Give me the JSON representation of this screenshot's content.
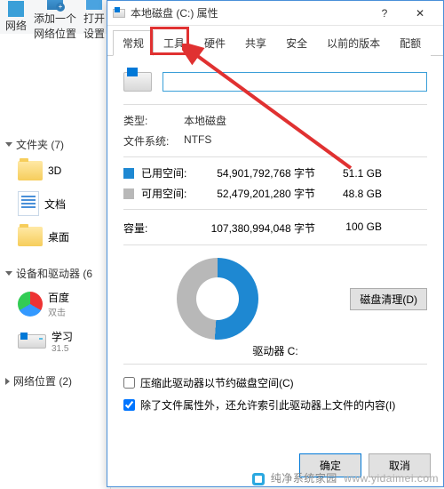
{
  "explorer": {
    "toolbar": {
      "net": "网络",
      "add_location": "添加一个\n网络位置",
      "open_settings": "打开\n设置"
    },
    "folders_title": "文件夹 (7)",
    "folders": [
      {
        "label": "3D"
      },
      {
        "label": "文档"
      },
      {
        "label": "桌面"
      }
    ],
    "devices_title": "设备和驱动器 (6",
    "devices": [
      {
        "label": "百度",
        "sub": "双击"
      },
      {
        "label": "学习",
        "sub": "31.5"
      }
    ],
    "netloc_title": "网络位置 (2)"
  },
  "dialog": {
    "title": "本地磁盘 (C:) 属性",
    "tabs": {
      "general": "常规",
      "tools": "工具",
      "hardware": "硬件",
      "sharing": "共享",
      "security": "安全",
      "previous": "以前的版本",
      "quota": "配额"
    },
    "drive_name": "",
    "type_label": "类型:",
    "type_value": "本地磁盘",
    "fs_label": "文件系统:",
    "fs_value": "NTFS",
    "used_label": "已用空间:",
    "used_bytes": "54,901,792,768 字节",
    "used_gb": "51.1 GB",
    "free_label": "可用空间:",
    "free_bytes": "52,479,201,280 字节",
    "free_gb": "48.8 GB",
    "capacity_label": "容量:",
    "capacity_bytes": "107,380,994,048 字节",
    "capacity_gb": "100 GB",
    "drive_caption": "驱动器 C:",
    "cleanup": "磁盘清理(D)",
    "compress": "压缩此驱动器以节约磁盘空间(C)",
    "indexing": "除了文件属性外，还允许索引此驱动器上文件的内容(I)",
    "ok": "确定",
    "cancel": "取消"
  },
  "watermark": {
    "brand": "纯净系统家园",
    "url": "www.yidaimei.com"
  }
}
